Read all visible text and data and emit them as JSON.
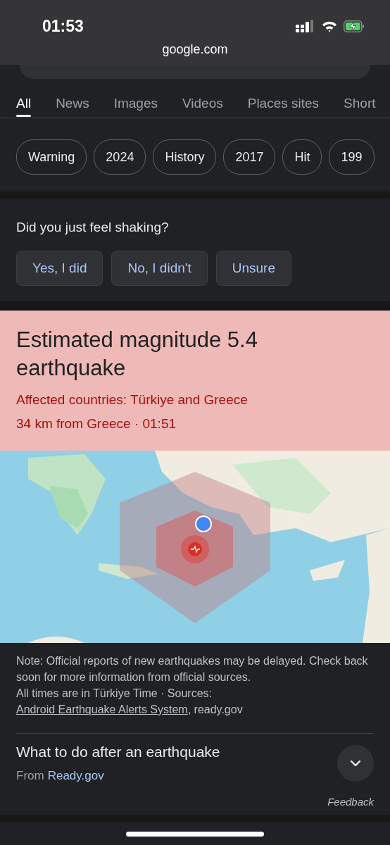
{
  "status_bar": {
    "time": "01:53"
  },
  "browser": {
    "url": "google.com"
  },
  "tabs": [
    {
      "label": "All",
      "selected": true
    },
    {
      "label": "News",
      "selected": false
    },
    {
      "label": "Images",
      "selected": false
    },
    {
      "label": "Videos",
      "selected": false
    },
    {
      "label": "Places sites",
      "selected": false
    },
    {
      "label": "Short",
      "selected": false
    }
  ],
  "chips": [
    "Warning",
    "2024",
    "History",
    "2017",
    "Hit",
    "199"
  ],
  "shaking_prompt": {
    "question": "Did you just feel shaking?",
    "options": [
      "Yes, I did",
      "No, I didn't",
      "Unsure"
    ]
  },
  "alert": {
    "title": "Estimated magnitude 5.4 earthquake",
    "countries": "Affected countries: Türkiye and Greece",
    "distance": "34 km from Greece · 01:51"
  },
  "note": {
    "text": "Note: Official reports of new earthquakes may be delayed. Check back soon for more information from official sources.",
    "sources_prefix": "All times are in Türkiye Time · Sources:",
    "sources_link": "Android Earthquake Alerts System",
    "sources_suffix": ", ready.gov"
  },
  "guide": {
    "title": "What to do after an earthquake",
    "from_label": "From",
    "source_link": "Ready.gov",
    "expanded": false
  },
  "feedback": "Feedback"
}
